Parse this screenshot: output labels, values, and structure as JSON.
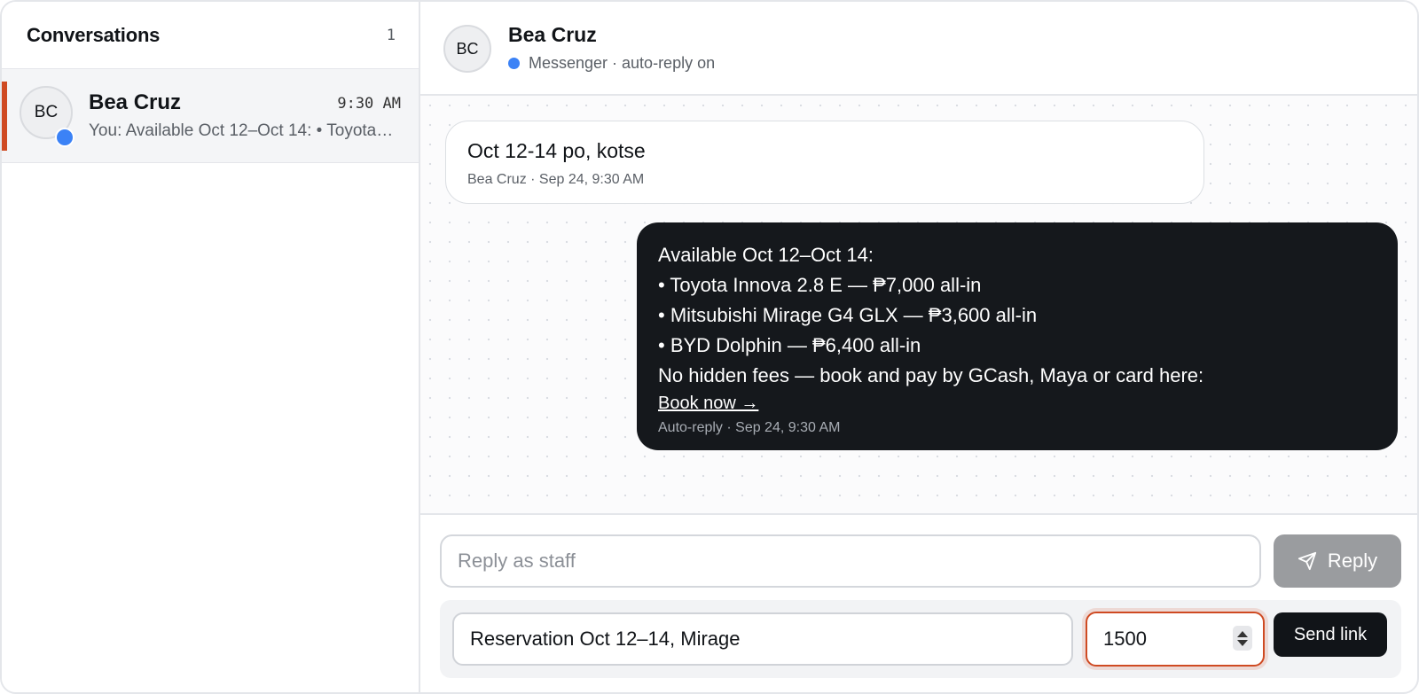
{
  "sidebar": {
    "title": "Conversations",
    "count": "1",
    "conversations": [
      {
        "initials": "BC",
        "name": "Bea Cruz",
        "time": "9:30 AM",
        "preview": "You: Available Oct 12–Oct 14: • Toyota Innova 2.8 E — ₱7,000 all-in",
        "online": true
      }
    ]
  },
  "chat": {
    "initials": "BC",
    "name": "Bea Cruz",
    "status": "Messenger · auto-reply on",
    "messages": [
      {
        "direction": "incoming",
        "text": "Oct 12-14 po, kotse",
        "meta": "Bea Cruz · Sep 24, 9:30 AM"
      },
      {
        "direction": "outgoing",
        "lines": [
          "Available Oct 12–Oct 14:",
          "• Toyota Innova 2.8 E — ₱7,000 all-in",
          "• Mitsubishi Mirage G4 GLX — ₱3,600 all-in",
          "• BYD Dolphin — ₱6,400 all-in",
          "No hidden fees — book and pay by GCash, Maya or card here:"
        ],
        "link_label": "Book now →",
        "meta": "Auto-reply · Sep 24, 9:30 AM"
      }
    ]
  },
  "composer": {
    "reply_placeholder": "Reply as staff",
    "reply_button": "Reply",
    "payment": {
      "description": "Reservation Oct 12–14, Mirage",
      "amount": "1500",
      "send_button": "Send link"
    }
  },
  "colors": {
    "accent": "#cf4a22",
    "online": "#3b82f6",
    "dark_bubble": "#15181c",
    "disabled_button": "#9a9c9f"
  }
}
